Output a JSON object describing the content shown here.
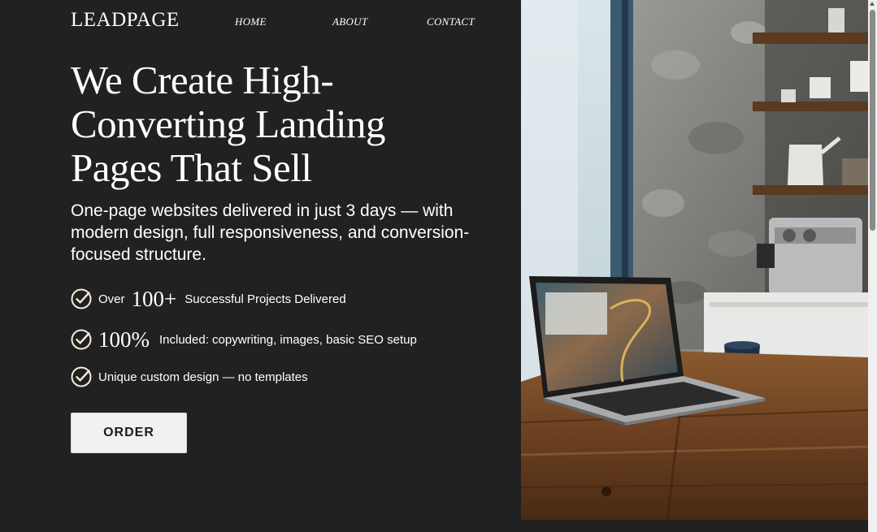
{
  "header": {
    "logo": "LEADPAGE",
    "nav": {
      "home": "HOME",
      "about": "ABOUT",
      "contact": "CONTACT"
    }
  },
  "hero": {
    "title_line1": "We Create High-",
    "title_line2": "Converting Landing",
    "title_line3": "Pages That Sell",
    "subtitle": "One-page websites delivered in just 3 days — with modern design, full responsiveness, and conversion-focused structure."
  },
  "features": [
    {
      "prefix": "Over",
      "big": "100+",
      "text": "Successful Projects Delivered"
    },
    {
      "big": "100%",
      "text": "Included: copywriting, images, basic SEO setup"
    },
    {
      "text": "Unique custom design — no templates"
    }
  ],
  "cta": {
    "order_label": "ORDER"
  },
  "icons": {
    "feature_check": "check-circle-icon",
    "scroll_up": "arrow-up-icon"
  },
  "colors": {
    "background": "#212121",
    "text": "#ffffff",
    "check_circle": "#f4ecd8",
    "button_bg": "#f1f1f1",
    "button_text": "#1b1b1b"
  }
}
